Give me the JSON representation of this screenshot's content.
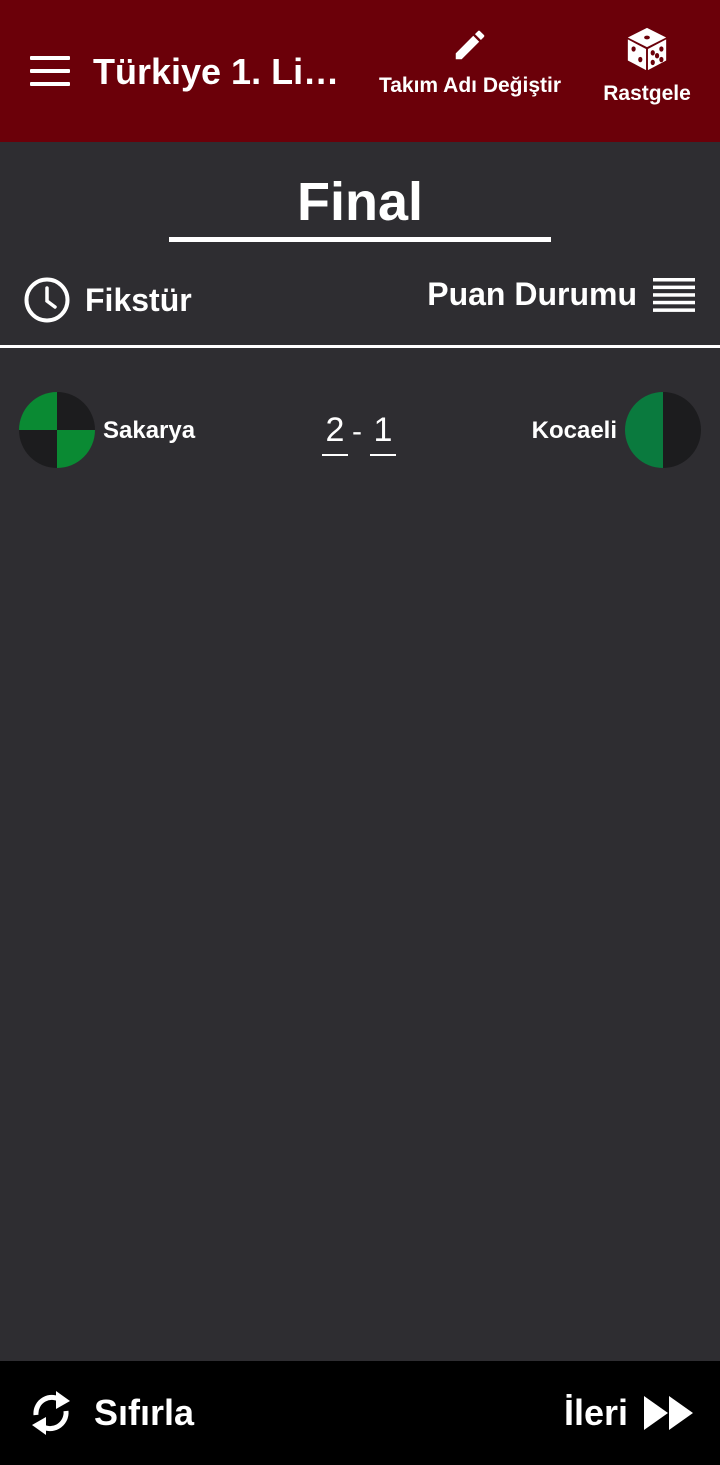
{
  "appbar": {
    "title": "Türkiye 1. Lig...",
    "rename_label": "Takım Adı Değiştir",
    "random_label": "Rastgele",
    "background": "#6b0009"
  },
  "round": {
    "title": "Final"
  },
  "tabs": {
    "fixture_label": "Fikstür",
    "standings_label": "Puan Durumu"
  },
  "match": {
    "home_team": "Sakarya",
    "away_team": "Kocaeli",
    "home_score": "2",
    "away_score": "1",
    "separator": "-",
    "home_colors": [
      "#0a8a33",
      "#1c1c1e"
    ],
    "away_colors": [
      "#0a7a3e",
      "#1c1c1e"
    ]
  },
  "bottom": {
    "reset_label": "Sıfırla",
    "next_label": "İleri"
  },
  "icons": {
    "menu": "menu-icon",
    "rename": "pencil-icon",
    "random": "dice-icon",
    "fixture": "clock-icon",
    "standings": "list-icon",
    "reset": "refresh-icon",
    "next": "fast-forward-icon"
  }
}
